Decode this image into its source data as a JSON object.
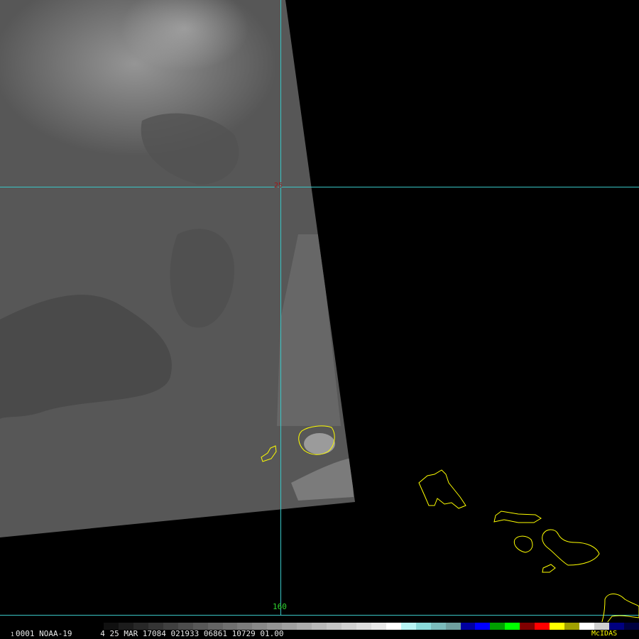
{
  "image": {
    "frame_number": "1",
    "status_line": "0001 NOAA-19      4 25 MAR 17084 021933 06861 10729 01.00",
    "software": "McIDAS"
  },
  "graticule": {
    "latitude_label": "25",
    "longitude_label": "160",
    "line_color": "#39c6c6"
  },
  "coastline_color": "#ffff00",
  "color_bar": [
    "#101010",
    "#1c1c1c",
    "#282828",
    "#343434",
    "#404040",
    "#4c4c4c",
    "#585858",
    "#646464",
    "#707070",
    "#7c7c7c",
    "#888888",
    "#949494",
    "#a0a0a0",
    "#acacac",
    "#b8b8b8",
    "#c4c4c4",
    "#d0d0d0",
    "#dcdcdc",
    "#e8e8e8",
    "#ffffff",
    "#b8f4f4",
    "#8adada",
    "#7bbbbb",
    "#6f9f9f",
    "#0000a0",
    "#0000ff",
    "#00a000",
    "#00ff00",
    "#800000",
    "#ff0000",
    "#ffff00",
    "#a0a000",
    "#ffffff",
    "#d0d0d0",
    "#000080",
    "#000040"
  ]
}
